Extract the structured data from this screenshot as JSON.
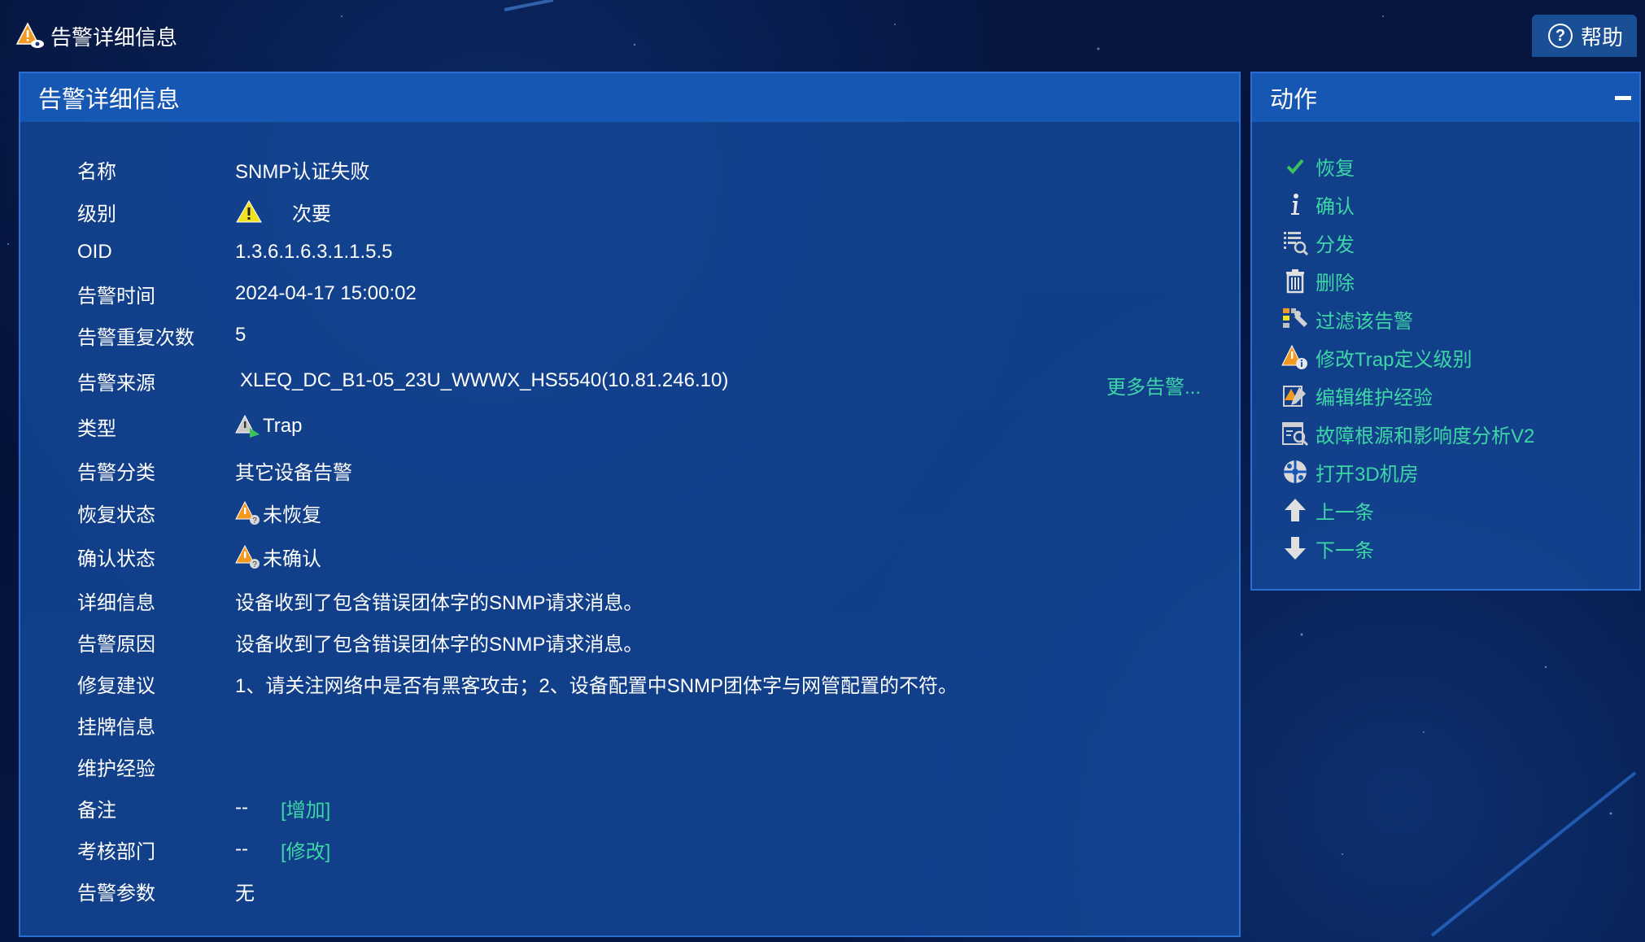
{
  "window": {
    "title": "告警详细信息",
    "help_label": "帮助"
  },
  "main": {
    "header": "告警详细信息",
    "fields": [
      {
        "label": "名称",
        "value": "SNMP认证失败"
      },
      {
        "label": "级别",
        "value": "次要"
      },
      {
        "label": "OID",
        "value": "1.3.6.1.6.3.1.1.5.5"
      },
      {
        "label": "告警时间",
        "value": "2024-04-17 15:00:02"
      },
      {
        "label": "告警重复次数",
        "value": "5"
      },
      {
        "label": "告警来源",
        "value": "XLEQ_DC_B1-05_23U_WWWX_HS5540(10.81.246.10)"
      },
      {
        "label": "类型",
        "value": "Trap"
      },
      {
        "label": "告警分类",
        "value": "其它设备告警"
      },
      {
        "label": "恢复状态",
        "value": "未恢复"
      },
      {
        "label": "确认状态",
        "value": "未确认"
      },
      {
        "label": "详细信息",
        "value": "设备收到了包含错误团体字的SNMP请求消息。"
      },
      {
        "label": "告警原因",
        "value": "设备收到了包含错误团体字的SNMP请求消息。"
      },
      {
        "label": "修复建议",
        "value": "1、请关注网络中是否有黑客攻击；2、设备配置中SNMP团体字与网管配置的不符。"
      },
      {
        "label": "挂牌信息",
        "value": ""
      },
      {
        "label": "维护经验",
        "value": ""
      },
      {
        "label": "备注",
        "value": "--",
        "link": "[增加]"
      },
      {
        "label": "考核部门",
        "value": "--",
        "link": "[修改]"
      },
      {
        "label": "告警参数",
        "value": "无"
      }
    ],
    "more_alarms": "更多告警..."
  },
  "actions": {
    "header": "动作",
    "items": [
      {
        "label": "恢复",
        "icon": "check-icon"
      },
      {
        "label": "确认",
        "icon": "info-icon"
      },
      {
        "label": "分发",
        "icon": "distribute-icon"
      },
      {
        "label": "删除",
        "icon": "trash-icon"
      },
      {
        "label": "过滤该告警",
        "icon": "filter-icon"
      },
      {
        "label": "修改Trap定义级别",
        "icon": "alarm-edit-level-icon"
      },
      {
        "label": "编辑维护经验",
        "icon": "edit-experience-icon"
      },
      {
        "label": "故障根源和影响度分析V2",
        "icon": "root-cause-analysis-icon"
      },
      {
        "label": "打开3D机房",
        "icon": "3d-room-icon"
      },
      {
        "label": "上一条",
        "icon": "arrow-up-icon"
      },
      {
        "label": "下一条",
        "icon": "arrow-down-icon"
      }
    ]
  },
  "colors": {
    "link": "#3dd6a6",
    "panel_header": "#1657b3",
    "panel_body": "#144696"
  }
}
